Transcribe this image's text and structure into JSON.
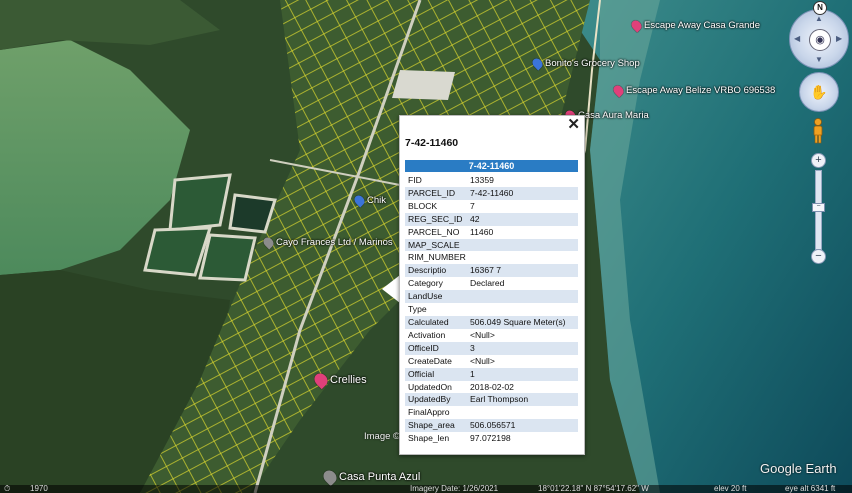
{
  "balloon": {
    "title": "7-42-11460",
    "header": "7-42-11460",
    "close_label": "✕",
    "rows": [
      {
        "key": "FID",
        "value": "13359"
      },
      {
        "key": "PARCEL_ID",
        "value": "7-42-11460"
      },
      {
        "key": "BLOCK",
        "value": "7"
      },
      {
        "key": "REG_SEC_ID",
        "value": "42"
      },
      {
        "key": "PARCEL_NO",
        "value": "11460"
      },
      {
        "key": "MAP_SCALE",
        "value": ""
      },
      {
        "key": "RIM_NUMBER",
        "value": ""
      },
      {
        "key": "Descriptio",
        "value": "16367 7"
      },
      {
        "key": "Category",
        "value": "Declared"
      },
      {
        "key": "LandUse",
        "value": ""
      },
      {
        "key": "Type",
        "value": ""
      },
      {
        "key": "Calculated",
        "value": "506.049 Square Meter(s)"
      },
      {
        "key": "Activation",
        "value": "<Null>"
      },
      {
        "key": "OfficeID",
        "value": "3"
      },
      {
        "key": "CreateDate",
        "value": "<Null>"
      },
      {
        "key": "Official",
        "value": "1"
      },
      {
        "key": "UpdatedOn",
        "value": "2018-02-02"
      },
      {
        "key": "UpdatedBy",
        "value": "Earl Thompson"
      },
      {
        "key": "FinalAppro",
        "value": ""
      },
      {
        "key": "Shape_area",
        "value": "506.056571"
      },
      {
        "key": "Shape_len",
        "value": "97.072198"
      }
    ]
  },
  "places": [
    {
      "label": "Escape Away Casa Grande",
      "icon": "pink"
    },
    {
      "label": "Bonito's Grocery Shop",
      "icon": "blue"
    },
    {
      "label": "Escape Away Belize VRBO 696538",
      "icon": "pink"
    },
    {
      "label": "Casa Aura Maria",
      "icon": "pink"
    },
    {
      "label": "Chik",
      "icon": "blue"
    },
    {
      "label": "Cayo Frances Ltd / Marinos",
      "icon": "gray"
    },
    {
      "label": "Crellies",
      "icon": "pink"
    },
    {
      "label": "Casa Punta Azul",
      "icon": "gray"
    }
  ],
  "nav": {
    "north_label": "N",
    "zoom_in": "+",
    "zoom_out": "−",
    "slider_knob": "−"
  },
  "footer": {
    "historical_year": "1970",
    "imagery_date": "Imagery Date: 1/26/2021",
    "coords": "18°01'22.18\" N  87°54'17.62\" W",
    "elev": "elev  20 ft",
    "eye_alt": "eye alt  6341 ft",
    "image_credit": "Image ©",
    "brand": "Google Earth"
  },
  "colors": {
    "header_bar": "#2a7cc4",
    "row_alt": "#dbe5f1",
    "parcel_lines": "#e8e23a"
  }
}
